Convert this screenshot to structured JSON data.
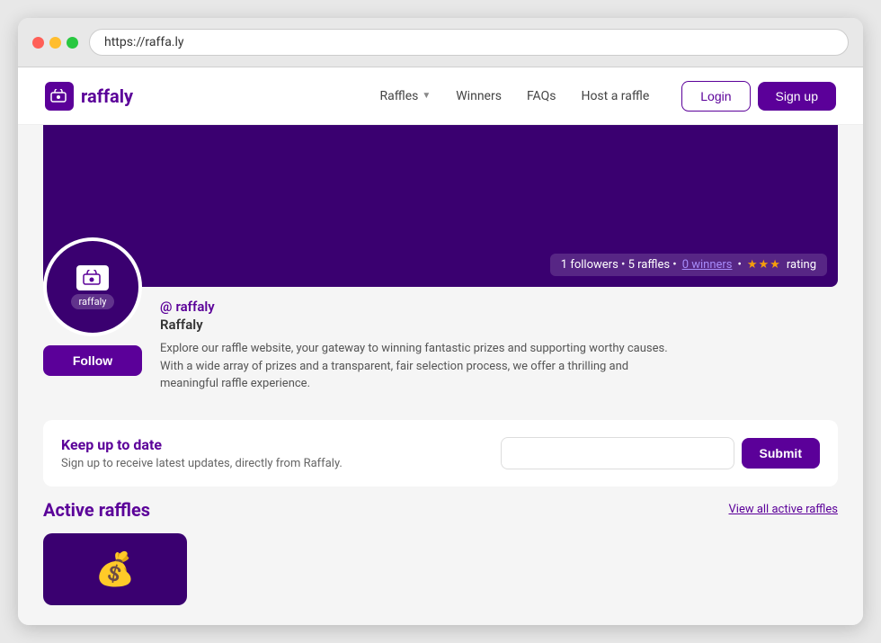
{
  "browser": {
    "url": "https://raffa.ly"
  },
  "navbar": {
    "logo_text": "raffaly",
    "nav_items": [
      {
        "label": "Raffles",
        "has_dropdown": true
      },
      {
        "label": "Winners",
        "has_dropdown": false
      },
      {
        "label": "FAQs",
        "has_dropdown": false
      },
      {
        "label": "Host a raffle",
        "has_dropdown": false
      }
    ],
    "login_label": "Login",
    "signup_label": "Sign up"
  },
  "hero": {
    "stats": "1 followers  •  5 raffles  •",
    "winners_label": "0 winners",
    "rating_label": "rating"
  },
  "profile": {
    "handle": "@raffaly",
    "name": "Raffaly",
    "bio": "Explore our raffle website, your gateway to winning fantastic prizes and supporting worthy causes. With a wide array of prizes and a transparent, fair selection process, we offer a thrilling and meaningful raffle experience.",
    "follow_label": "Follow",
    "avatar_tag": "raffaly"
  },
  "newsletter": {
    "title": "Keep up to date",
    "description": "Sign up to receive latest updates, directly from Raffaly.",
    "input_placeholder": "",
    "submit_label": "Submit"
  },
  "active_raffles": {
    "title": "Active raffles",
    "view_all_label": "View all active raffles"
  }
}
